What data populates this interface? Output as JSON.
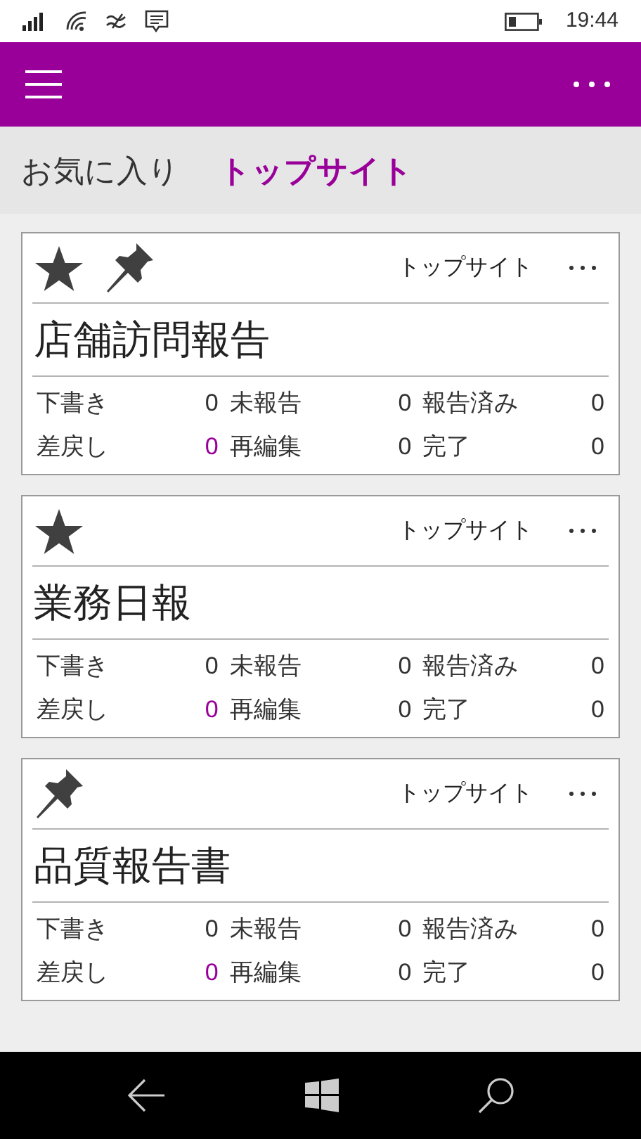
{
  "status_bar": {
    "time": "19:44"
  },
  "tabs": [
    {
      "label": "お気に入り",
      "selected": false
    },
    {
      "label": "トップサイト",
      "selected": true
    }
  ],
  "cards": [
    {
      "favorite": true,
      "pinned": true,
      "source": "トップサイト",
      "title": "店舗訪問報告",
      "stats": [
        {
          "label": "下書き",
          "value": "0",
          "highlighted": false
        },
        {
          "label": "未報告",
          "value": "0",
          "highlighted": false
        },
        {
          "label": "報告済み",
          "value": "0",
          "highlighted": false
        },
        {
          "label": "差戻し",
          "value": "0",
          "highlighted": true
        },
        {
          "label": "再編集",
          "value": "0",
          "highlighted": false
        },
        {
          "label": "完了",
          "value": "0",
          "highlighted": false
        }
      ]
    },
    {
      "favorite": true,
      "pinned": false,
      "source": "トップサイト",
      "title": "業務日報",
      "stats": [
        {
          "label": "下書き",
          "value": "0",
          "highlighted": false
        },
        {
          "label": "未報告",
          "value": "0",
          "highlighted": false
        },
        {
          "label": "報告済み",
          "value": "0",
          "highlighted": false
        },
        {
          "label": "差戻し",
          "value": "0",
          "highlighted": true
        },
        {
          "label": "再編集",
          "value": "0",
          "highlighted": false
        },
        {
          "label": "完了",
          "value": "0",
          "highlighted": false
        }
      ]
    },
    {
      "favorite": false,
      "pinned": true,
      "source": "トップサイト",
      "title": "品質報告書",
      "stats": [
        {
          "label": "下書き",
          "value": "0",
          "highlighted": false
        },
        {
          "label": "未報告",
          "value": "0",
          "highlighted": false
        },
        {
          "label": "報告済み",
          "value": "0",
          "highlighted": false
        },
        {
          "label": "差戻し",
          "value": "0",
          "highlighted": true
        },
        {
          "label": "再編集",
          "value": "0",
          "highlighted": false
        },
        {
          "label": "完了",
          "value": "0",
          "highlighted": false
        }
      ]
    }
  ]
}
